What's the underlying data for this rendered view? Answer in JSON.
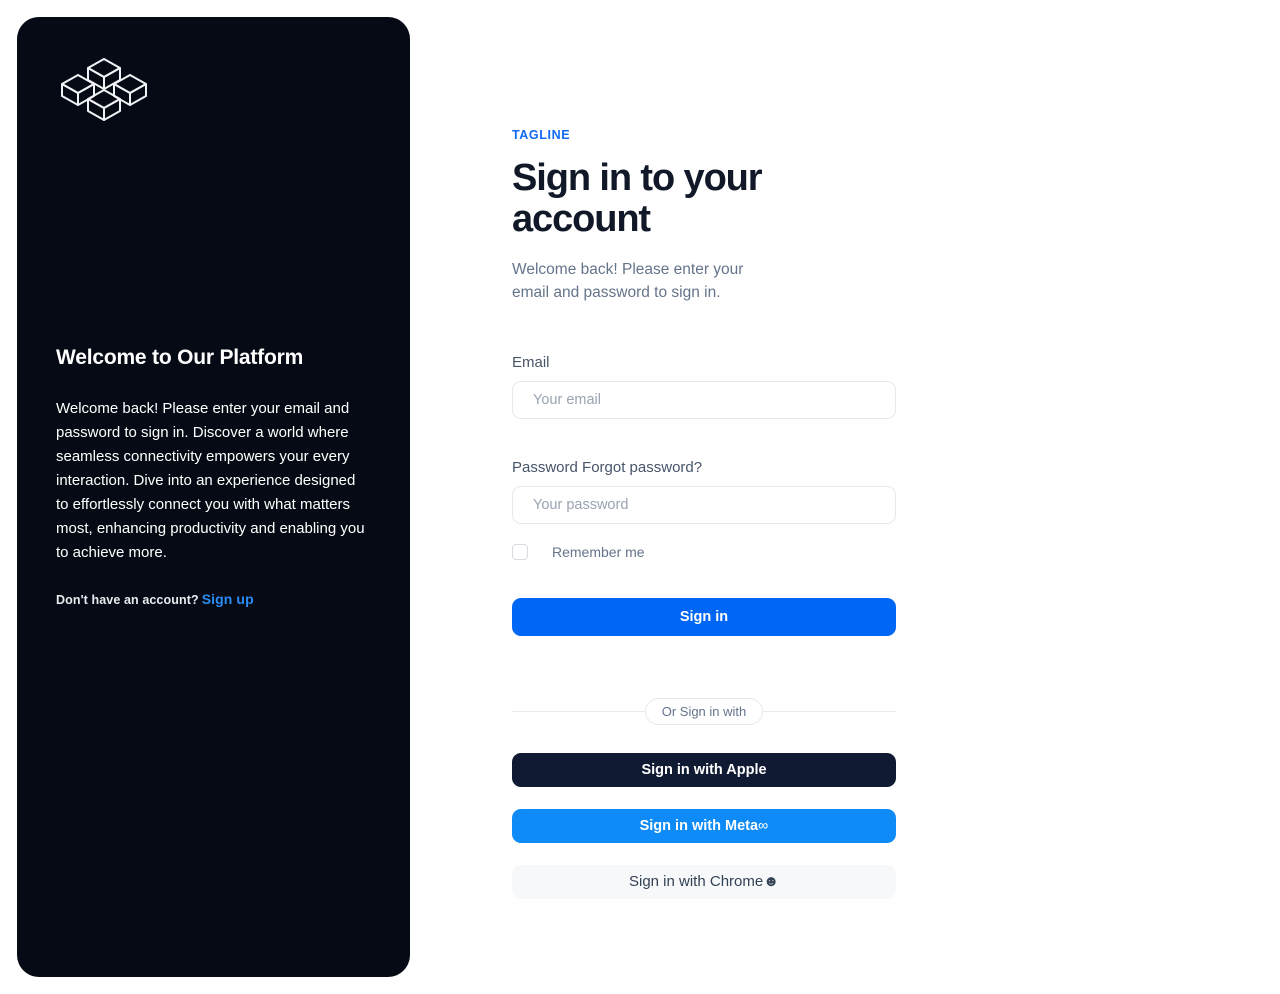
{
  "hero": {
    "logo_icon": "cubes-logo-icon",
    "title": "Welcome to Our Platform",
    "paragraph": "Welcome back! Please enter your email and password to sign in. Discover a world where seamless connectivity empowers your every interaction. Dive into an experience designed to effortlessly connect you with what matters most, enhancing productivity and enabling you to achieve more.",
    "footer_text": "Don't have an account?",
    "signup_label": "Sign up"
  },
  "form": {
    "tagline": "TAGLINE",
    "heading": "Sign in to your account",
    "subtitle": "Welcome back! Please enter your email and password to sign in.",
    "email": {
      "label": "Email",
      "placeholder": "Your email",
      "value": ""
    },
    "password": {
      "label": "Password Forgot password?",
      "label_main": "Password",
      "forgot_label": "Forgot password?",
      "placeholder": "Your password",
      "value": ""
    },
    "remember": {
      "label": "Remember me",
      "checked": false
    },
    "submit_label": "Sign in",
    "divider_label": "Or Sign in with",
    "social": [
      {
        "label": "Sign in with Apple",
        "glyph": "",
        "icon": "apple-icon",
        "bg": "#101a33",
        "fg": "#ffffff"
      },
      {
        "label": "Sign in with Meta",
        "glyph": "∞",
        "icon": "meta-infinity-icon",
        "bg": "#0f8bf7",
        "fg": "#ffffff"
      },
      {
        "label": "Sign in with Chrome",
        "glyph": "☻",
        "icon": "chrome-icon",
        "bg": "#f7f8fa",
        "fg": "#334155"
      }
    ]
  },
  "colors": {
    "panel_bg": "#050a14",
    "accent_blue": "#0066f5",
    "tagline_blue": "#1169f4",
    "link_blue": "#2b8cf5",
    "heading_dark": "#111827",
    "muted_text": "#64748b",
    "page_bg": "#ffffff"
  }
}
